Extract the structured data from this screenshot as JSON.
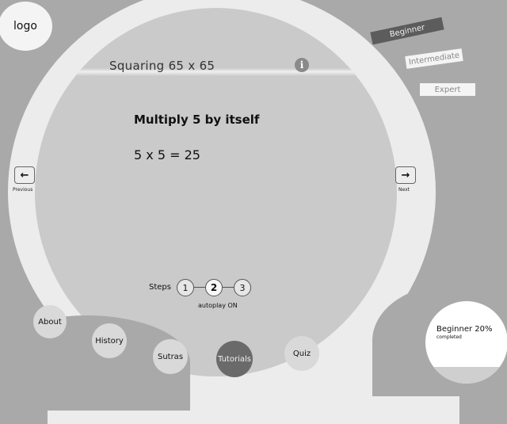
{
  "logo": {
    "text": "logo"
  },
  "levels": [
    {
      "label": "Beginner",
      "selected": true
    },
    {
      "label": "Intermediate",
      "selected": false
    },
    {
      "label": "Expert",
      "selected": false
    }
  ],
  "lesson": {
    "title": "Squaring 65 x 65",
    "info_icon": "info-icon",
    "instruction": "Multiply 5 by itself",
    "equation": "5 x 5 = 25"
  },
  "navigation": {
    "previous_label": "Previous",
    "next_label": "Next",
    "previous_icon": "arrow-left-icon",
    "next_icon": "arrow-right-icon"
  },
  "steps": {
    "label": "Steps",
    "items": [
      "1",
      "2",
      "3"
    ],
    "current": "2",
    "autoplay": "autoplay ON"
  },
  "menu": [
    {
      "label": "About",
      "active": false
    },
    {
      "label": "History",
      "active": false
    },
    {
      "label": "Sutras",
      "active": false
    },
    {
      "label": "Tutorials",
      "active": true
    },
    {
      "label": "Quiz",
      "active": false
    }
  ],
  "progress": {
    "title": "Beginner 20%",
    "subtitle": "completed",
    "percent": 20
  },
  "colors": {
    "background": "#a9a9a9",
    "ring": "#ececec",
    "panel": "#cacaca",
    "active_menu": "#6a6a6a",
    "selected_level": "#5c5c5c"
  }
}
